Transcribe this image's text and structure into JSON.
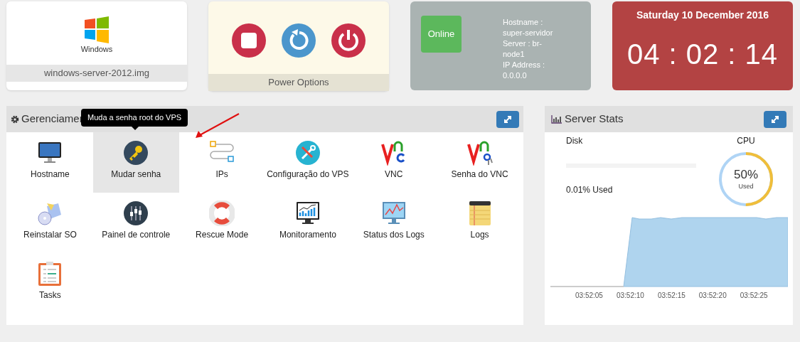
{
  "image_card": {
    "logo_text": "Windows",
    "filename": "windows-server-2012.img"
  },
  "power_card": {
    "buttons": [
      {
        "kind": "stop"
      },
      {
        "kind": "restart"
      },
      {
        "kind": "power"
      }
    ],
    "label": "Power Options"
  },
  "server_card": {
    "status": "Online",
    "details": [
      "Hostname :",
      "super-servidor",
      "Server : br-",
      "node1",
      "IP Address :",
      "0.0.0.0"
    ]
  },
  "clock_card": {
    "date": "Saturday 10 December 2016",
    "time": "04 : 02 : 14"
  },
  "management": {
    "title": "Gerenciamer",
    "tooltip": "Muda a senha root do VPS",
    "items": [
      {
        "label": "Hostname",
        "kind": "monitor",
        "selected": false
      },
      {
        "label": "Mudar senha",
        "kind": "key",
        "selected": true
      },
      {
        "label": "IPs",
        "kind": "ips",
        "selected": false
      },
      {
        "label": "Configuração do VPS",
        "kind": "tools",
        "selected": false
      },
      {
        "label": "VNC",
        "kind": "vnc",
        "selected": false
      },
      {
        "label": "Senha do VNC",
        "kind": "vnckey",
        "selected": false
      },
      {
        "label": "Reinstalar SO",
        "kind": "box",
        "selected": false
      },
      {
        "label": "Painel de controle",
        "kind": "sliders",
        "selected": false
      },
      {
        "label": "Rescue Mode",
        "kind": "lifebuoy",
        "selected": false
      },
      {
        "label": "Monitoramento",
        "kind": "chartmonitor",
        "selected": false
      },
      {
        "label": "Status dos Logs",
        "kind": "linemonitor",
        "selected": false
      },
      {
        "label": "Logs",
        "kind": "notepad",
        "selected": false
      },
      {
        "label": "Tasks",
        "kind": "clipboard",
        "selected": false
      }
    ]
  },
  "server_stats": {
    "title": "Server Stats",
    "disk": {
      "label": "Disk",
      "level": 0.0001,
      "reading": "0.01% Used"
    },
    "cpu": {
      "label": "CPU",
      "level": 0.5,
      "reading": "50%",
      "caption": "Used"
    },
    "chart_times": [
      "03:52:05",
      "03:52:10",
      "03:52:15",
      "03:52:20",
      "03:52:25"
    ]
  }
}
